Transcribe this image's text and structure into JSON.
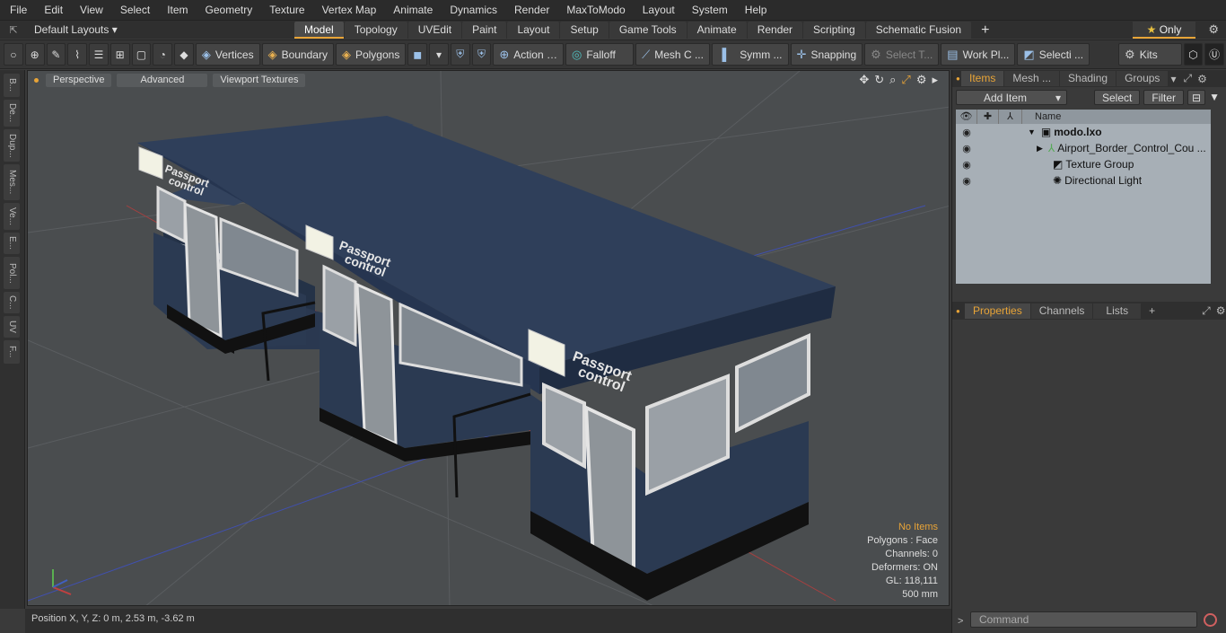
{
  "menu": [
    "File",
    "Edit",
    "View",
    "Select",
    "Item",
    "Geometry",
    "Texture",
    "Vertex Map",
    "Animate",
    "Dynamics",
    "Render",
    "MaxToModo",
    "Layout",
    "System",
    "Help"
  ],
  "layouts_label": "Default Layouts ▾",
  "layout_tabs": [
    "Model",
    "Topology",
    "UVEdit",
    "Paint",
    "Layout",
    "Setup",
    "Game Tools",
    "Animate",
    "Render",
    "Scripting",
    "Schematic Fusion"
  ],
  "only_label": "Only",
  "toolbar": {
    "vertices": "Vertices",
    "boundary": "Boundary",
    "polygons": "Polygons",
    "action": "Action",
    "falloff": "Falloff",
    "mesh": "Mesh C ...",
    "symm": "Symm ...",
    "snapping": "Snapping",
    "select_t": "Select T...",
    "work_pl": "Work Pl...",
    "selecti": "Selecti ...",
    "kits": "Kits"
  },
  "left_tabs": [
    "B...",
    "De...",
    "Dup...",
    "Mes...",
    "Ve...",
    "E...",
    "Pol...",
    "C...",
    "UV",
    "F..."
  ],
  "viewport": {
    "perspective": "Perspective",
    "advanced": "Advanced",
    "textures": "Viewport Textures",
    "sign_text_1": "Passport",
    "sign_text_2": "control",
    "info": {
      "no_items": "No Items",
      "polygons": "Polygons : Face",
      "channels": "Channels: 0",
      "deformers": "Deformers: ON",
      "gl": "GL: 118,111",
      "size": "500 mm"
    }
  },
  "status": "Position X, Y, Z:   0 m, 2.53 m, -3.62 m",
  "panel": {
    "tabs": [
      "Items",
      "Mesh ...",
      "Shading",
      "Groups"
    ],
    "add_item": "Add Item",
    "select": "Select",
    "filter": "Filter",
    "name_col": "Name",
    "tree": [
      {
        "label": "modo.lxo",
        "bold": true
      },
      {
        "label": "Airport_Border_Control_Cou ..."
      },
      {
        "label": "Texture Group"
      },
      {
        "label": "Directional Light"
      }
    ],
    "prop_tabs": [
      "Properties",
      "Channels",
      "Lists"
    ],
    "command_placeholder": "Command"
  }
}
